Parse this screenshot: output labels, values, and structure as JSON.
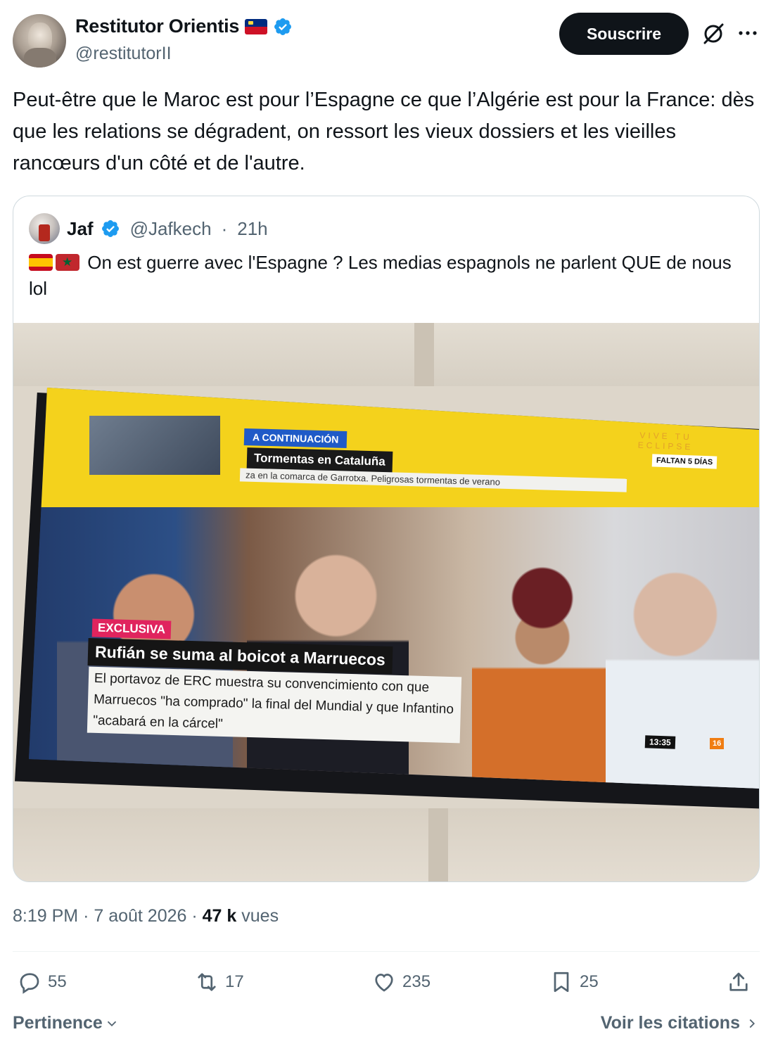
{
  "author": {
    "display_name": "Restitutor Orientis",
    "handle": "@restitutorII",
    "flag": "liechtenstein-flag-icon",
    "subscribe_label": "Souscrire"
  },
  "tweet": {
    "text": "Peut-être que le Maroc est pour l’Espagne ce que l’Algérie est pour la France: dès que les relations se dégradent, on ressort les vieux dossiers et les vieilles rancœurs d'un côté et de l'autre."
  },
  "quote": {
    "display_name": "Jaf",
    "handle": "@Jafkech",
    "time": "21h",
    "text": "On est guerre avec l'Espagne ? Les medias espagnols ne parlent QUE de nous lol",
    "flags": [
      "spain-flag-icon",
      "morocco-flag-icon"
    ],
    "image": {
      "tag_continuation": "A CONTINUACIÓN",
      "tag_storms": "Tormentas en Cataluña",
      "ticker": "za en la comarca de Garrotxa. Peligrosas tormentas de verano",
      "eclipse_line1": "VIVE TU",
      "eclipse_line2": "ECLIPSE",
      "countdown": "FALTAN 5 DÍAS",
      "exclusive_tag": "EXCLUSIVA",
      "headline": "Rufián se suma al boicot a Marruecos",
      "subline": "El portavoz de ERC muestra su convencimiento con que Marruecos \"ha comprado\" la final del Mundial y que Infantino \"acabará en la cárcel\"",
      "clock": "13:35",
      "age_rating": "16"
    }
  },
  "meta": {
    "time": "8:19 PM",
    "separator": "·",
    "date": "7 août 2026",
    "views_count": "47 k",
    "views_label": "vues"
  },
  "actions": {
    "replies": "55",
    "reposts": "17",
    "likes": "235",
    "bookmarks": "25"
  },
  "footer": {
    "sort_label": "Pertinence",
    "quotes_label": "Voir les citations"
  },
  "colors": {
    "text": "#0f1419",
    "secondary": "#536471",
    "verified": "#1d9bf0",
    "border": "#cfd9de"
  }
}
